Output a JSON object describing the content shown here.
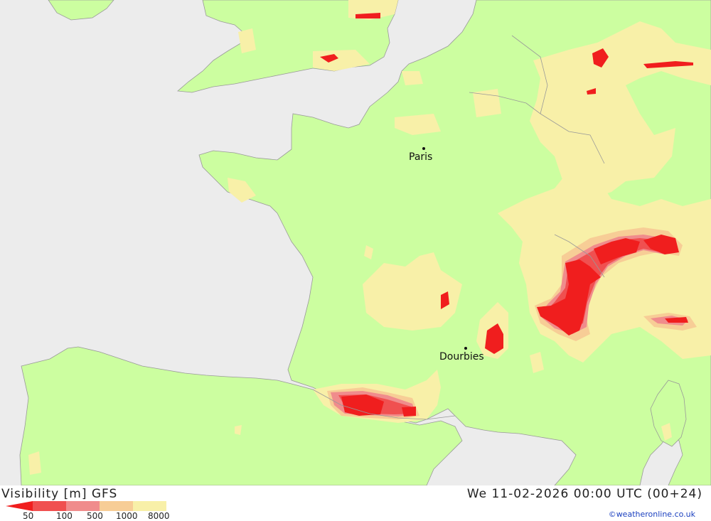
{
  "map": {
    "title": "Visibility [m] GFS",
    "valid_time": "We 11-02-2026 00:00 UTC (00+24)",
    "credit": "©weatheronline.co.uk",
    "colors": {
      "sea": "#ececec",
      "land": "#ccfea0",
      "vis_1000_8000": "#f8f0a8",
      "vis_500_1000": "#f7cd96",
      "vis_100_500": "#f08c8c",
      "vis_50_100": "#f05050",
      "vis_below_50": "#f01e1e"
    },
    "legend": {
      "ticks": [
        "50",
        "100",
        "500",
        "1000",
        "8000"
      ]
    },
    "cities": [
      {
        "name": "Paris"
      },
      {
        "name": "Dourbies"
      }
    ]
  }
}
